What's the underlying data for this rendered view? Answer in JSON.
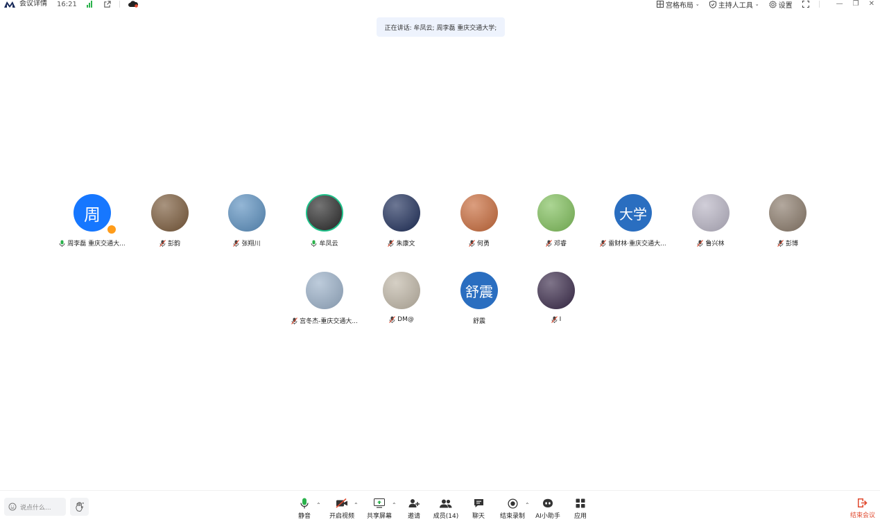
{
  "topbar": {
    "meeting_details": "会议详情",
    "time": "16:21",
    "grid_layout": "宫格布局",
    "host_tools": "主持人工具",
    "settings": "设置"
  },
  "speaking_text": "正在讲话: 牟凤云; 周李磊 重庆交通大学;",
  "participants_row1": [
    {
      "name": "周李磊 重庆交通大...",
      "avatar_text": "周",
      "avatar_color": "#1677ff",
      "mic": "on",
      "host": true
    },
    {
      "name": "彭韵",
      "avatar_color": "#7a5a3a",
      "mic": "muted"
    },
    {
      "name": "张翔川",
      "avatar_color": "#5a8fbf",
      "mic": "muted"
    },
    {
      "name": "牟凤云",
      "avatar_color": "#2a2a2a",
      "mic": "on",
      "speaking": true
    },
    {
      "name": "朱康文",
      "avatar_color": "#1e2e5a",
      "mic": "muted"
    },
    {
      "name": "何勇",
      "avatar_color": "#c86a3a",
      "mic": "muted"
    },
    {
      "name": "邓睿",
      "avatar_color": "#7fbf5a",
      "mic": "muted"
    },
    {
      "name": "雷财林·重庆交通大...",
      "avatar_text": "大学",
      "avatar_color": "#2a6ec0",
      "mic": "muted"
    },
    {
      "name": "鲁兴林",
      "avatar_color": "#b8b4c4",
      "mic": "muted"
    },
    {
      "name": "彭博",
      "avatar_color": "#8a7a6a",
      "mic": "muted"
    }
  ],
  "participants_row2": [
    {
      "name": "宫冬杰-重庆交通大...",
      "avatar_color": "#9ab0c8",
      "mic": "muted"
    },
    {
      "name": "DM@",
      "avatar_color": "#bfb6a6",
      "mic": "muted"
    },
    {
      "name": "舒震",
      "avatar_text": "舒震",
      "avatar_color": "#2a6ec0",
      "mic": "none"
    },
    {
      "name": "I",
      "avatar_color": "#3a2a4a",
      "mic": "muted"
    }
  ],
  "bottombar": {
    "chat_placeholder": "说点什么...",
    "mute": "静音",
    "video": "开启视频",
    "share": "共享屏幕",
    "invite": "邀请",
    "members": "成员(14)",
    "chat": "聊天",
    "stop_record": "结束录制",
    "ai": "AI小助手",
    "apps": "应用",
    "end": "结束会议"
  },
  "colors": {
    "accent": "#1677ff",
    "speaking_ring": "#1fc28a",
    "mic_on": "#2bb24c",
    "muted_red": "#e04a2f",
    "end_red": "#e04a2f"
  }
}
